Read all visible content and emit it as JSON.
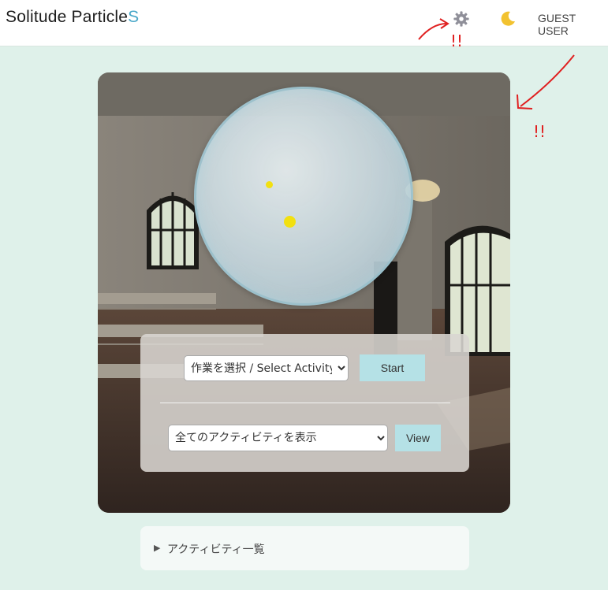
{
  "header": {
    "brand_main": "Solitude Particle",
    "brand_accent": "S",
    "user_label": "GUEST USER"
  },
  "icons": {
    "settings": "gear-icon",
    "theme": "moon-icon"
  },
  "annotation": {
    "marks": "!!",
    "color": "#e02020"
  },
  "controls": {
    "activity_select": {
      "selected": "作業を選択 / Select Activity",
      "options": [
        "作業を選択 / Select Activity"
      ]
    },
    "start_label": "Start",
    "view_select": {
      "selected": "全てのアクティビティを表示",
      "options": [
        "全てのアクティビティを表示"
      ]
    },
    "view_label": "View"
  },
  "details": {
    "summary": "アクティビティ一覧"
  },
  "colors": {
    "background": "#dff1ea",
    "accent": "#4aa8c9",
    "button": "#b5e1e6",
    "dot": "#f2e010"
  }
}
